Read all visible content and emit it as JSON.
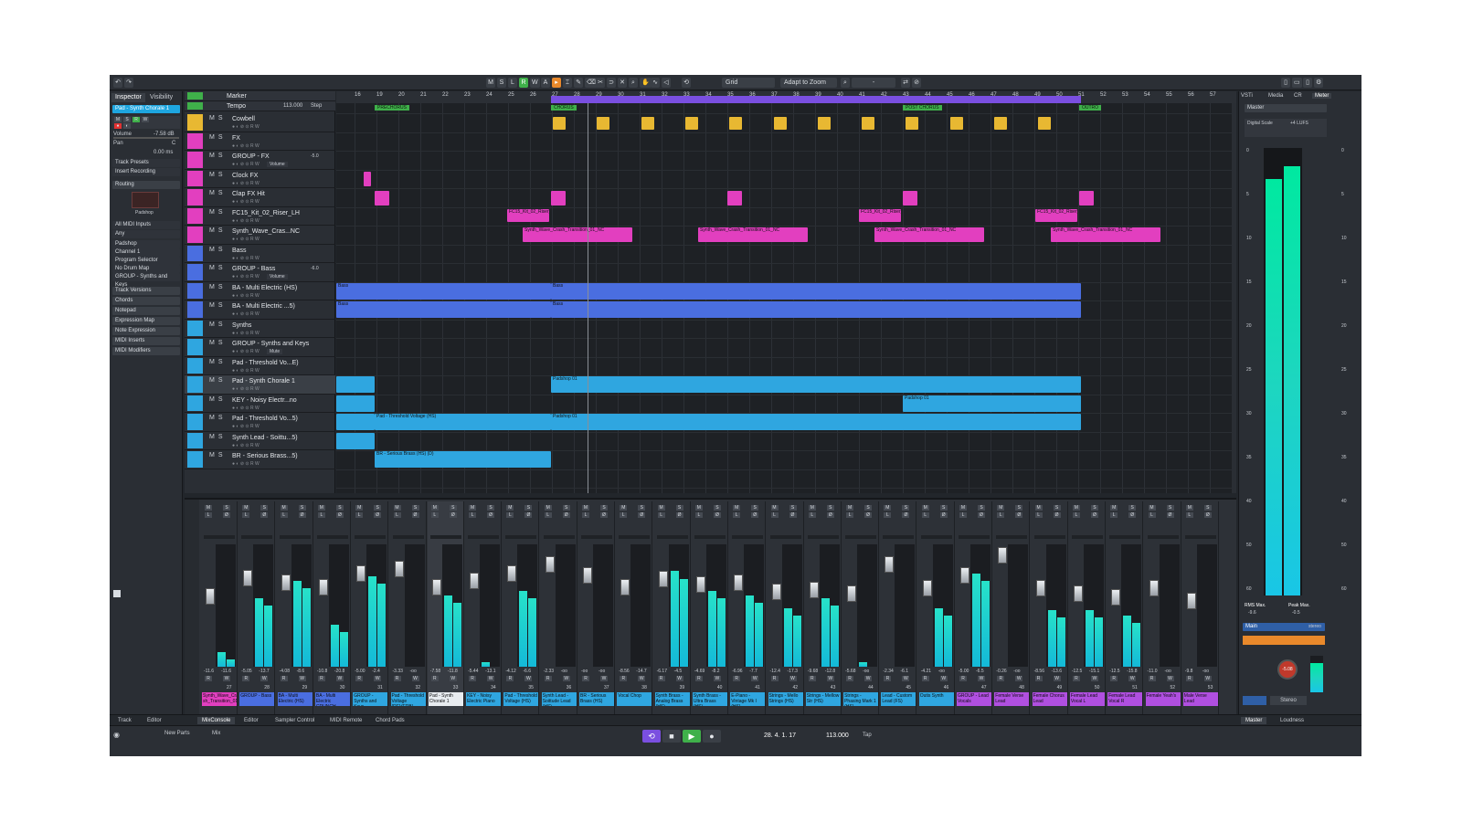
{
  "toolbar": {
    "grid_label": "Grid",
    "zoom_label": "Adapt to Zoom",
    "btn_m": "M",
    "btn_s": "S",
    "btn_l": "L",
    "btn_r": "R",
    "btn_w": "W",
    "btn_a": "A"
  },
  "inspector": {
    "tab_inspector": "Inspector",
    "tab_visibility": "Visibility",
    "track_name": "Pad - Synth Chorale 1",
    "volume_label": "Volume",
    "volume_value": "-7.58 dB",
    "pan_label": "Pan",
    "pan_value": "C",
    "delay_value": "0.00 ms",
    "track_presets": "Track Presets",
    "insert_recording": "Insert Recording",
    "routing": "Routing",
    "plugin_name": "Padshop",
    "midi_in": "All MIDI Inputs",
    "any": "Any",
    "instrument": "Padshop",
    "channel": "Channel 1",
    "program": "Program Selector",
    "drum_map": "No Drum Map",
    "group": "GROUP - Synths and Keys",
    "sections": [
      "Track Versions",
      "Chords",
      "Notepad",
      "Expression Map",
      "Note Expression",
      "MIDI Inserts",
      "MIDI Modifiers"
    ]
  },
  "tracks": {
    "marker": "Marker",
    "tempo": "Tempo",
    "tempo_value": "113.000",
    "tempo_mode": "Step",
    "items": [
      {
        "name": "Cowbell",
        "color": "#e8b832"
      },
      {
        "name": "FX",
        "color": "#e23fbf"
      },
      {
        "name": "GROUP - FX",
        "color": "#e23fbf",
        "sub": "Volume",
        "value": "-5.0"
      },
      {
        "name": "Clock FX",
        "color": "#e23fbf"
      },
      {
        "name": "Clap FX Hit",
        "color": "#e23fbf"
      },
      {
        "name": "FC15_Kit_02_Riser_LH",
        "color": "#e23fbf"
      },
      {
        "name": "Synth_Wave_Cras...NC",
        "color": "#e23fbf"
      },
      {
        "name": "Bass",
        "color": "#4a6ee0"
      },
      {
        "name": "GROUP - Bass",
        "color": "#4a6ee0",
        "sub": "Volume",
        "value": "-6.0"
      },
      {
        "name": "BA - Multi Electric (HS)",
        "color": "#4a6ee0"
      },
      {
        "name": "BA - Multi Electric ...5)",
        "color": "#4a6ee0"
      },
      {
        "name": "Synths",
        "color": "#2fa6e0"
      },
      {
        "name": "GROUP - Synths and Keys",
        "color": "#2fa6e0",
        "sub": "Mute"
      },
      {
        "name": "Pad - Threshold Vo...E)",
        "color": "#2fa6e0"
      },
      {
        "name": "Pad - Synth Chorale 1",
        "color": "#2fa6e0"
      },
      {
        "name": "KEY - Noisy Electr...no",
        "color": "#2fa6e0"
      },
      {
        "name": "Pad - Threshold Vo...5)",
        "color": "#2fa6e0"
      },
      {
        "name": "Synth Lead - Soittu...5)",
        "color": "#2fa6e0"
      },
      {
        "name": "BR - Serious Brass...5)",
        "color": "#2fa6e0"
      }
    ]
  },
  "ruler": {
    "bars": [
      "16",
      "19",
      "20",
      "21",
      "22",
      "23",
      "24",
      "25",
      "26",
      "27",
      "28",
      "29",
      "30",
      "31",
      "32",
      "33",
      "34",
      "35",
      "36",
      "37",
      "38",
      "39",
      "40",
      "41",
      "42",
      "43",
      "44",
      "45",
      "46",
      "47",
      "48",
      "49",
      "50",
      "51",
      "52",
      "53",
      "54",
      "55",
      "56",
      "57"
    ]
  },
  "markers": [
    {
      "label": "PRECHORUS"
    },
    {
      "label": "CHORUS"
    },
    {
      "label": "POST CHORUS"
    },
    {
      "label": "OUTRO"
    }
  ],
  "events": {
    "riser": "FC15_Kit_02_Riser_",
    "crash": "Synth_Wave_Crash_Transition_01_NC",
    "bass": "Bass",
    "padshop": "Padshop 01",
    "pad_thresh": "Pad - Threshold Voltage (HS)",
    "brass": "BR - Serious Brass (HS) (D)"
  },
  "mixer": {
    "strips": [
      {
        "label": "Synth_Wave_Cra sh_Transition_01",
        "color": "#e23fbf",
        "vol": "-11.6",
        "pk": "-11.6",
        "num": "27"
      },
      {
        "label": "GROUP - Bass",
        "color": "#4a6ee0",
        "vol": "-5.05",
        "pk": "-13.7",
        "num": "28"
      },
      {
        "label": "BA - Multi Electric (HS)",
        "color": "#4a6ee0",
        "vol": "-4.08",
        "pk": "-8.6",
        "num": "29"
      },
      {
        "label": "BA - Multi Electric CRUNCH",
        "color": "#4a6ee0",
        "vol": "-10.8",
        "pk": "-20.8",
        "num": "30"
      },
      {
        "label": "GROUP - Synths and Keys",
        "color": "#2fa6e0",
        "vol": "-5.00",
        "pk": "-2.4",
        "num": "31"
      },
      {
        "label": "Pad - Threshold Voltage (REVERB)",
        "color": "#2fa6e0",
        "vol": "-3.33",
        "pk": "-oo",
        "num": "32"
      },
      {
        "label": "Pad - Synth Chorale 1",
        "color": "#e8ecf0",
        "vol": "-7.58",
        "pk": "-11.8",
        "num": "33"
      },
      {
        "label": "KEY - Noisy Electric Piano",
        "color": "#2fa6e0",
        "vol": "-5.44",
        "pk": "-13.1",
        "num": "34"
      },
      {
        "label": "Pad - Threshold Voltage (HS)",
        "color": "#2fa6e0",
        "vol": "-4.12",
        "pk": "-6.6",
        "num": "35"
      },
      {
        "label": "Synth Lead - Soittude Lead (HS)",
        "color": "#2fa6e0",
        "vol": "-2.33",
        "pk": "-oo",
        "num": "36"
      },
      {
        "label": "BR - Serious Brass (HS)",
        "color": "#2fa6e0",
        "vol": "-oo",
        "pk": "-oo",
        "num": "37"
      },
      {
        "label": "Vocal Chop",
        "color": "#2fa6e0",
        "vol": "-8.56",
        "pk": "-14.7",
        "num": "38"
      },
      {
        "label": "Synth Brass - Analog Brass (HS)",
        "color": "#2fa6e0",
        "vol": "-6.17",
        "pk": "-4.5",
        "num": "39"
      },
      {
        "label": "Synth Brass - Ultra Brass (HS)",
        "color": "#2fa6e0",
        "vol": "-4.69",
        "pk": "-8.2",
        "num": "40"
      },
      {
        "label": "E-Piano - Vintage Mk I (HS)",
        "color": "#2fa6e0",
        "vol": "-6.96",
        "pk": "-7.7",
        "num": "41"
      },
      {
        "label": "Strings - Mello Strings (HS)",
        "color": "#2fa6e0",
        "vol": "-12.4",
        "pk": "-17.3",
        "num": "42"
      },
      {
        "label": "Strings - Mellow Str (HS)",
        "color": "#2fa6e0",
        "vol": "-9.68",
        "pk": "-12.8",
        "num": "43"
      },
      {
        "label": "Strings - Phasing Mark 1 (HS)",
        "color": "#2fa6e0",
        "vol": "-5.68",
        "pk": "-oo",
        "num": "44"
      },
      {
        "label": "Lead - Custom Lead (FS)",
        "color": "#2fa6e0",
        "vol": "-2.34",
        "pk": "-6.1",
        "num": "45"
      },
      {
        "label": "Outis Synth",
        "color": "#2fa6e0",
        "vol": "-4.21",
        "pk": "-oo",
        "num": "46"
      },
      {
        "label": "GROUP - Lead Vocals",
        "color": "#b04fe0",
        "vol": "-5.00",
        "pk": "-6.5",
        "num": "47"
      },
      {
        "label": "Female Verse Lead",
        "color": "#b04fe0",
        "vol": "-0.26",
        "pk": "-oo",
        "num": "48"
      },
      {
        "label": "Female Chorus Lead",
        "color": "#b04fe0",
        "vol": "-8.56",
        "pk": "-13.6",
        "num": "49"
      },
      {
        "label": "Female Lead Vocal L",
        "color": "#b04fe0",
        "vol": "-12.5",
        "pk": "-15.1",
        "num": "50"
      },
      {
        "label": "Female Lead Vocal R",
        "color": "#b04fe0",
        "vol": "-12.5",
        "pk": "-15.8",
        "num": "51"
      },
      {
        "label": "Female Yeah's",
        "color": "#b04fe0",
        "vol": "-11.0",
        "pk": "-oo",
        "num": "52"
      },
      {
        "label": "Male Verse Lead",
        "color": "#b04fe0",
        "vol": "-9.8",
        "pk": "-oo",
        "num": "53"
      }
    ]
  },
  "right_zone": {
    "tabs": [
      "VSTi",
      "Media",
      "CR",
      "Meter"
    ],
    "master": "Master",
    "scale": "Digital Scale",
    "scale_value": "+4 LUFS",
    "rms_label": "RMS Max.",
    "rms_value": "-9.6",
    "peak_label": "Peak Max.",
    "peak_value": "-0.5",
    "main_label": "Main",
    "main_mode": "stereo",
    "knob_value": "-5.08",
    "stereo": "Stereo",
    "scale_ticks": [
      "0",
      "5",
      "10",
      "15",
      "20",
      "25",
      "30",
      "35",
      "40",
      "50",
      "60"
    ]
  },
  "bottom": {
    "tabs": [
      "Track",
      "Editor",
      "MixConsole",
      "Editor",
      "Sampler Control",
      "MIDI Remote",
      "Chord Pads"
    ],
    "right_tabs": [
      "Master",
      "Loudness"
    ]
  },
  "transport": {
    "new_parts": "New Parts",
    "mix": "Mix",
    "position": "28. 4. 1. 17",
    "tempo": "113.000",
    "tap": "Tap"
  }
}
